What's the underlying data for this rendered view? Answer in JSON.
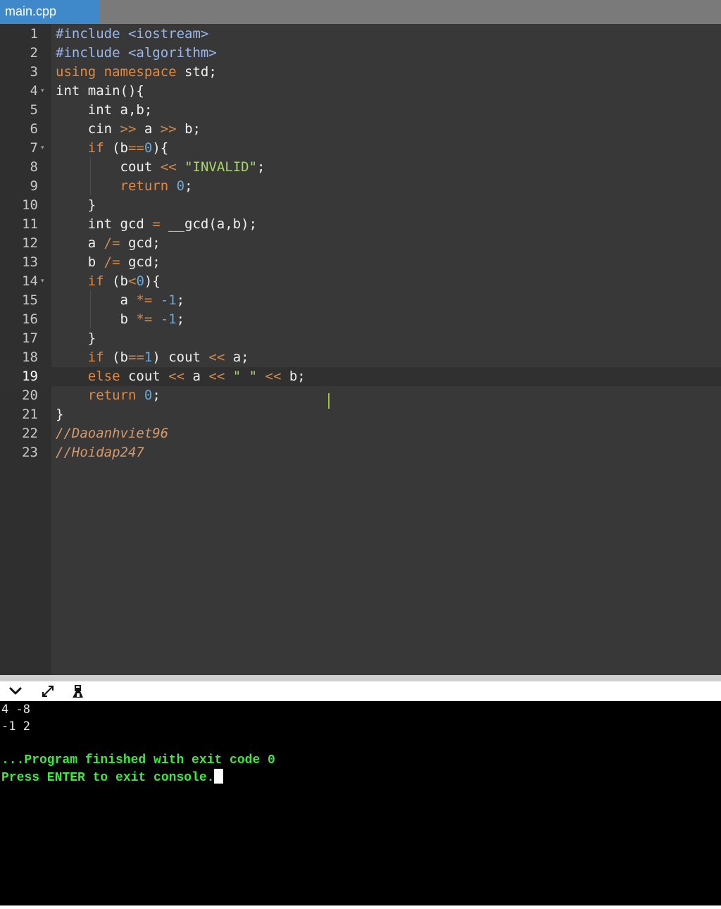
{
  "tab": {
    "label": "main.cpp"
  },
  "editor": {
    "active_line": 19,
    "lines": [
      {
        "n": "1",
        "fold": false,
        "tokens": [
          [
            "inc",
            "#include"
          ],
          [
            "p",
            " "
          ],
          [
            "inc",
            "<iostream>"
          ]
        ]
      },
      {
        "n": "2",
        "fold": false,
        "tokens": [
          [
            "inc",
            "#include"
          ],
          [
            "p",
            " "
          ],
          [
            "inc",
            "<algorithm>"
          ]
        ]
      },
      {
        "n": "3",
        "fold": false,
        "tokens": [
          [
            "kw",
            "using"
          ],
          [
            "p",
            " "
          ],
          [
            "kw",
            "namespace"
          ],
          [
            "p",
            " std;"
          ]
        ]
      },
      {
        "n": "4",
        "fold": true,
        "tokens": [
          [
            "p",
            "int main(){"
          ]
        ]
      },
      {
        "n": "5",
        "fold": false,
        "tokens": [
          [
            "p",
            "    int a,b;"
          ]
        ]
      },
      {
        "n": "6",
        "fold": false,
        "tokens": [
          [
            "p",
            "    cin "
          ],
          [
            "op",
            ">>"
          ],
          [
            "p",
            " a "
          ],
          [
            "op",
            ">>"
          ],
          [
            "p",
            " b;"
          ]
        ]
      },
      {
        "n": "7",
        "fold": true,
        "tokens": [
          [
            "p",
            "    "
          ],
          [
            "kw",
            "if"
          ],
          [
            "p",
            " (b"
          ],
          [
            "op",
            "=="
          ],
          [
            "num",
            "0"
          ],
          [
            "p",
            "){"
          ]
        ]
      },
      {
        "n": "8",
        "fold": false,
        "tokens": [
          [
            "p",
            "        cout "
          ],
          [
            "op",
            "<<"
          ],
          [
            "p",
            " "
          ],
          [
            "str",
            "\"INVALID\""
          ],
          [
            "p",
            ";"
          ]
        ]
      },
      {
        "n": "9",
        "fold": false,
        "tokens": [
          [
            "p",
            "        "
          ],
          [
            "kw",
            "return"
          ],
          [
            "p",
            " "
          ],
          [
            "num",
            "0"
          ],
          [
            "p",
            ";"
          ]
        ]
      },
      {
        "n": "10",
        "fold": false,
        "tokens": [
          [
            "p",
            "    }"
          ]
        ]
      },
      {
        "n": "11",
        "fold": false,
        "tokens": [
          [
            "p",
            "    int gcd "
          ],
          [
            "op",
            "="
          ],
          [
            "p",
            " __gcd(a,b);"
          ]
        ]
      },
      {
        "n": "12",
        "fold": false,
        "tokens": [
          [
            "p",
            "    a "
          ],
          [
            "op",
            "/="
          ],
          [
            "p",
            " gcd;"
          ]
        ]
      },
      {
        "n": "13",
        "fold": false,
        "tokens": [
          [
            "p",
            "    b "
          ],
          [
            "op",
            "/="
          ],
          [
            "p",
            " gcd;"
          ]
        ]
      },
      {
        "n": "14",
        "fold": true,
        "tokens": [
          [
            "p",
            "    "
          ],
          [
            "kw",
            "if"
          ],
          [
            "p",
            " (b"
          ],
          [
            "op",
            "<"
          ],
          [
            "num",
            "0"
          ],
          [
            "p",
            "){"
          ]
        ]
      },
      {
        "n": "15",
        "fold": false,
        "tokens": [
          [
            "p",
            "        a "
          ],
          [
            "op",
            "*="
          ],
          [
            "p",
            " "
          ],
          [
            "num",
            "-1"
          ],
          [
            "p",
            ";"
          ]
        ]
      },
      {
        "n": "16",
        "fold": false,
        "tokens": [
          [
            "p",
            "        b "
          ],
          [
            "op",
            "*="
          ],
          [
            "p",
            " "
          ],
          [
            "num",
            "-1"
          ],
          [
            "p",
            ";"
          ]
        ]
      },
      {
        "n": "17",
        "fold": false,
        "tokens": [
          [
            "p",
            "    }"
          ]
        ]
      },
      {
        "n": "18",
        "fold": false,
        "tokens": [
          [
            "p",
            "    "
          ],
          [
            "kw",
            "if"
          ],
          [
            "p",
            " (b"
          ],
          [
            "op",
            "=="
          ],
          [
            "num",
            "1"
          ],
          [
            "p",
            ") cout "
          ],
          [
            "op",
            "<<"
          ],
          [
            "p",
            " a;"
          ]
        ]
      },
      {
        "n": "19",
        "fold": false,
        "tokens": [
          [
            "p",
            "    "
          ],
          [
            "kw",
            "else"
          ],
          [
            "p",
            " cout "
          ],
          [
            "op",
            "<<"
          ],
          [
            "p",
            " a "
          ],
          [
            "op",
            "<<"
          ],
          [
            "p",
            " "
          ],
          [
            "str",
            "\" \""
          ],
          [
            "p",
            " "
          ],
          [
            "op",
            "<<"
          ],
          [
            "p",
            " b;"
          ]
        ]
      },
      {
        "n": "20",
        "fold": false,
        "tokens": [
          [
            "p",
            "    "
          ],
          [
            "kw",
            "return"
          ],
          [
            "p",
            " "
          ],
          [
            "num",
            "0"
          ],
          [
            "p",
            ";"
          ]
        ]
      },
      {
        "n": "21",
        "fold": false,
        "tokens": [
          [
            "p",
            "}"
          ]
        ]
      },
      {
        "n": "22",
        "fold": false,
        "tokens": [
          [
            "cmt",
            "//Daoanhviet96"
          ]
        ]
      },
      {
        "n": "23",
        "fold": false,
        "tokens": [
          [
            "cmt",
            "//Hoidap247"
          ]
        ]
      }
    ]
  },
  "console": {
    "toolbar_icons": [
      "chevron-down-icon",
      "expand-icon",
      "clear-console-icon"
    ],
    "output_lines": [
      "4 -8",
      "-1 2"
    ],
    "finish_message": "...Program finished with exit code 0",
    "prompt_message": "Press ENTER to exit console."
  },
  "colors": {
    "tab_active": "#3f88c9",
    "editor_bg": "#383838",
    "keyword": "#e08a46",
    "number": "#6aa8d8",
    "string": "#a8d46f",
    "console_text": "#3ee83e"
  }
}
